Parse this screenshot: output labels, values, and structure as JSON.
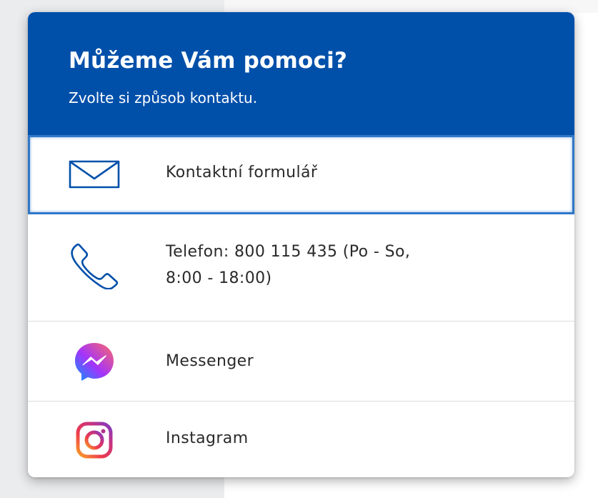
{
  "popup": {
    "title": "Můžeme Vám pomoci?",
    "subtitle": "Zvolte si způsob kontaktu.",
    "header_color": "#0050aa",
    "items": [
      {
        "label": "Kontaktní formulář",
        "icon": "envelope-icon",
        "focused": true
      },
      {
        "label": "Telefon: 800 115 435 (Po - So,\n8:00 - 18:00)",
        "icon": "phone-icon"
      },
      {
        "label": "Messenger",
        "icon": "messenger-icon"
      },
      {
        "label": "Instagram",
        "icon": "instagram-icon"
      }
    ]
  }
}
